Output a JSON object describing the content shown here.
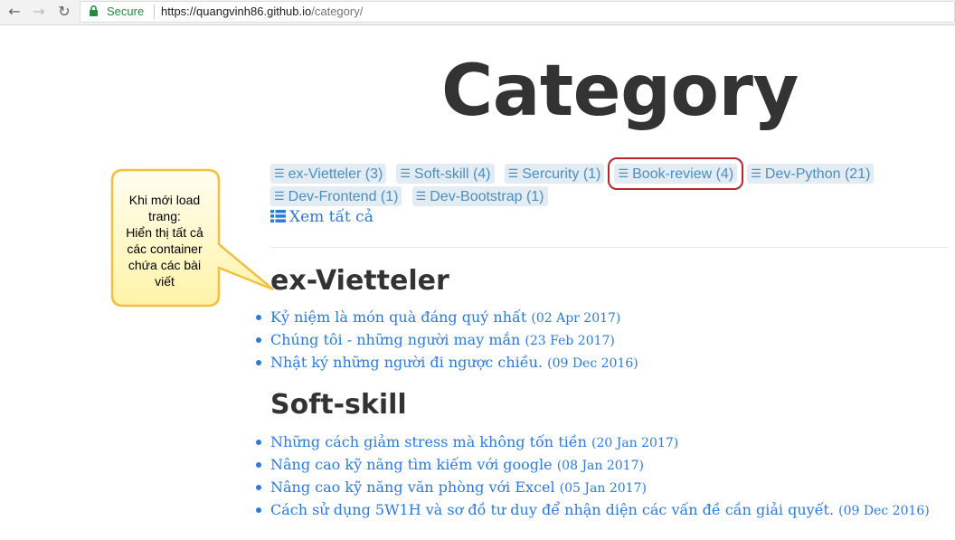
{
  "browser": {
    "secure_label": "Secure",
    "url_host": "https://quangvinh86.github.io",
    "url_path": "/category/"
  },
  "page": {
    "title": "Category",
    "view_all": "Xem tất cả"
  },
  "tags": [
    {
      "label": "ex-Vietteler (3)"
    },
    {
      "label": "Soft-skill (4)"
    },
    {
      "label": "Sercurity (1)"
    },
    {
      "label": "Book-review (4)",
      "highlighted": true
    },
    {
      "label": "Dev-Python (21)"
    },
    {
      "label": "Dev-Frontend (1)"
    },
    {
      "label": "Dev-Bootstrap (1)"
    }
  ],
  "sections": [
    {
      "title": "ex-Vietteler",
      "posts": [
        {
          "title": "Kỷ niệm là món quà đáng quý nhất",
          "date": "(02 Apr 2017)"
        },
        {
          "title": "Chúng tôi - những người may mắn",
          "date": "(23 Feb 2017)"
        },
        {
          "title": "Nhật ký những người đi ngược chiều.",
          "date": "(09 Dec 2016)"
        }
      ]
    },
    {
      "title": "Soft-skill",
      "posts": [
        {
          "title": "Những cách giảm stress mà không tốn tiền",
          "date": "(20 Jan 2017)"
        },
        {
          "title": "Nâng cao kỹ năng tìm kiếm với google",
          "date": "(08 Jan 2017)"
        },
        {
          "title": "Nâng cao kỹ năng văn phòng với Excel",
          "date": "(05 Jan 2017)"
        },
        {
          "title": "Cách sử dụng 5W1H và sơ đồ tư duy để nhận diện các vấn đề cần giải quyết.",
          "date": "(09 Dec 2016)"
        }
      ]
    }
  ],
  "annotation": {
    "lines": [
      "Khi mới load",
      "trang:",
      "Hiển thị tất cả",
      "các container",
      "chứa các bài",
      "viết"
    ]
  },
  "colors": {
    "link": "#2a7ae2",
    "tag_bg": "#e3ecf3",
    "tag_text": "#4a8ec2",
    "highlight_ring": "#b7262f",
    "callout_fill": "#fff9c4",
    "callout_border": "#f0c040"
  },
  "icons": {
    "back": "arrow-left-icon",
    "forward": "arrow-right-icon",
    "reload": "reload-icon",
    "lock": "lock-icon",
    "tag": "bars-icon",
    "view_all": "list-icon"
  }
}
